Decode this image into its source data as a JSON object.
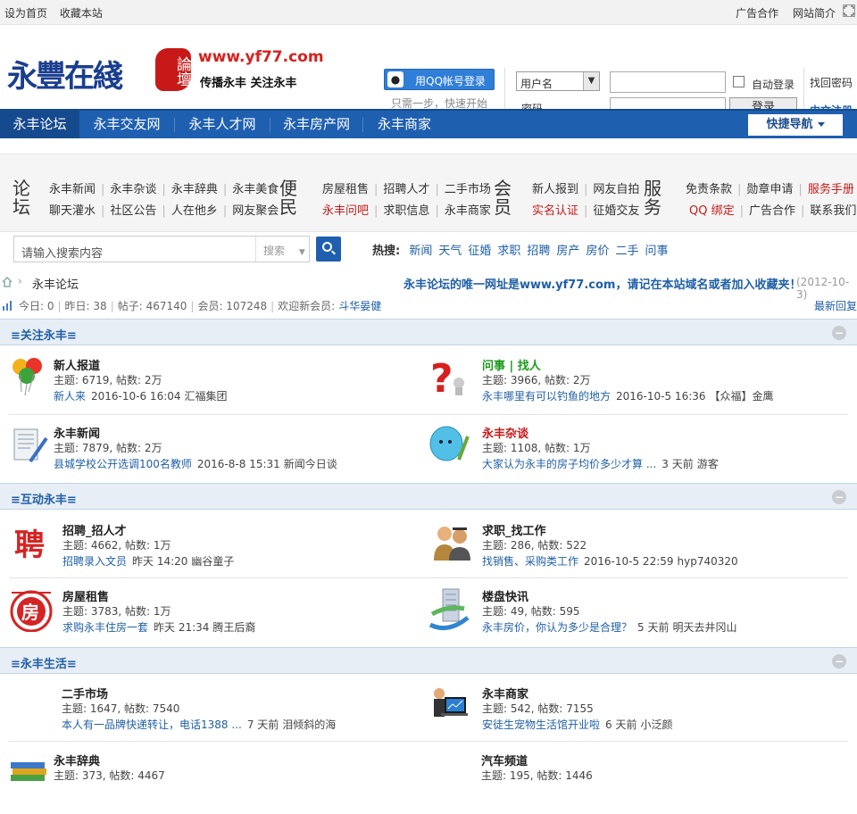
{
  "topbar": {
    "left": [
      "设为首页",
      "收藏本站"
    ],
    "right": [
      "广告合作",
      "网站简介"
    ]
  },
  "header": {
    "logo_text": "永豐在綫",
    "logo_seal": "論壇",
    "url": "www.yf77.com",
    "slogan": "传播永丰  关注永丰",
    "qq_button": "用QQ帐号登录",
    "qq_hint": "只需一步，快速开始",
    "login_type": "用户名",
    "password_label": "密码",
    "auto_login": "自动登录",
    "login_button": "登录",
    "forgot": "找回密码",
    "register": "中文注册"
  },
  "nav": {
    "items": [
      "永丰论坛",
      "永丰交友网",
      "永丰人才网",
      "永丰房产网",
      "永丰商家"
    ],
    "quick": "快捷导航"
  },
  "links": {
    "groups": [
      {
        "title": "论坛",
        "rows": [
          [
            "永丰新闻",
            "永丰杂谈",
            "永丰辞典",
            "永丰美食"
          ],
          [
            "聊天灌水",
            "社区公告",
            "人在他乡",
            "网友聚会"
          ]
        ]
      },
      {
        "title": "便民",
        "rows": [
          [
            "房屋租售",
            "招聘人才",
            "二手市场"
          ],
          [
            "永丰问吧",
            "求职信息",
            "永丰商家"
          ]
        ]
      },
      {
        "title": "会员",
        "rows": [
          [
            "新人报到",
            "网友自拍"
          ],
          [
            "实名认证",
            "征婚交友"
          ]
        ]
      },
      {
        "title": "服务",
        "rows": [
          [
            "免责条款",
            "勋章申请",
            "服务手册"
          ],
          [
            "QQ 绑定",
            "广告合作",
            "联系我们"
          ]
        ]
      }
    ]
  },
  "search": {
    "placeholder": "请输入搜索内容",
    "category": "搜索",
    "hot_label": "热搜:",
    "hot": [
      "新闻",
      "天气",
      "征婚",
      "求职",
      "招聘",
      "房产",
      "房价",
      "二手",
      "问事"
    ]
  },
  "breadcrumb": {
    "current": "永丰论坛",
    "notice": "永丰论坛的唯一网址是www.yf77.com，请记在本站域名或者加入收藏夹！",
    "date": "(2012-10-3)"
  },
  "stats": {
    "today": "今日: 0",
    "yesterday": "昨日: 38",
    "posts": "帖子: 467140",
    "members": "会员: 107248",
    "welcome": "欢迎新会员:",
    "newest": "斗华晏健",
    "latest": "最新回复"
  },
  "sections": [
    {
      "title": "≡关注永丰≡",
      "forums": [
        {
          "name": "新人报道",
          "counts": "主题: 6719, 帖数: 2万",
          "last_title": "新人来",
          "last_time": "2016-10-6 16:04",
          "last_user": "汇福集团",
          "icon": "balloons-icon"
        },
        {
          "name": "问事 | 找人",
          "counts": "主题: 3966, 帖数: 2万",
          "last_title": "永丰哪里有可以钓鱼的地方",
          "last_time": "2016-10-5 16:36",
          "last_user": "【众福】金鹰",
          "icon": "question-icon"
        },
        {
          "name": "永丰新闻",
          "counts": "主题: 7879, 帖数: 2万",
          "last_title": "县城学校公开选调100名教师",
          "last_time": "2016-8-8 15:31",
          "last_user": "新闻今日谈",
          "icon": "newspaper-icon"
        },
        {
          "name": "永丰杂谈",
          "counts": "主题: 1108, 帖数: 1万",
          "last_title": "大家认为永丰的房子均价多少才算 ...",
          "last_time": "3 天前",
          "last_user": "游客",
          "icon": "chat-icon"
        }
      ]
    },
    {
      "title": "≡互动永丰≡",
      "forums": [
        {
          "name": "招聘_招人才",
          "counts": "主题: 4662, 帖数: 1万",
          "last_title": "招聘录入文员",
          "last_time": "昨天 14:20",
          "last_user": "幽谷童子",
          "icon": "recruit-icon"
        },
        {
          "name": "求职_找工作",
          "counts": "主题: 286, 帖数: 522",
          "last_title": "找销售、采购类工作",
          "last_time": "2016-10-5 22:59",
          "last_user": "hyp740320",
          "icon": "job-seeker-icon"
        },
        {
          "name": "房屋租售",
          "counts": "主题: 3783, 帖数: 1万",
          "last_title": "求购永丰住房一套",
          "last_time": "昨天 21:34",
          "last_user": "腾王后裔",
          "icon": "house-sale-icon"
        },
        {
          "name": "楼盘快讯",
          "counts": "主题: 49, 帖数: 595",
          "last_title": "永丰房价，你认为多少是合理？",
          "last_time": "5 天前",
          "last_user": "明天去井冈山",
          "icon": "building-icon"
        }
      ]
    },
    {
      "title": "≡永丰生活≡",
      "forums": [
        {
          "name": "二手市场",
          "counts": "主题: 1647, 帖数: 7540",
          "last_title": "本人有一品牌快递转让，电话1388 ...",
          "last_time": "7 天前",
          "last_user": "泪倾斜的海",
          "icon": "none"
        },
        {
          "name": "永丰商家",
          "counts": "主题: 542, 帖数: 7155",
          "last_title": "安徒生宠物生活馆开业啦",
          "last_time": "6 天前",
          "last_user": "小泛颜",
          "icon": "merchant-icon"
        },
        {
          "name": "永丰辞典",
          "counts": "主题: 373, 帖数: 4467",
          "last_title": "",
          "last_time": "",
          "last_user": "",
          "icon": "books-icon"
        },
        {
          "name": "汽车频道",
          "counts": "主题: 195, 帖数: 1446",
          "last_title": "",
          "last_time": "",
          "last_user": "",
          "icon": "none"
        }
      ]
    }
  ]
}
